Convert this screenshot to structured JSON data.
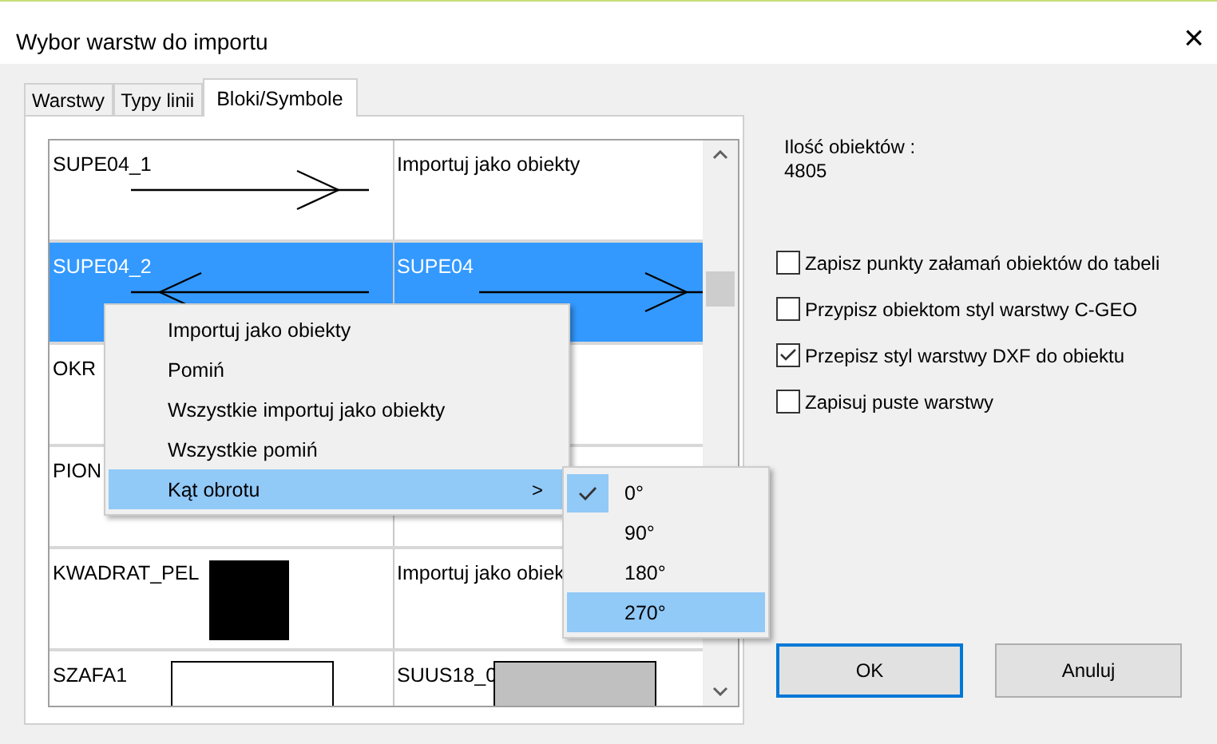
{
  "window": {
    "title": "Wybor warstw do importu",
    "close": "×"
  },
  "tabs": [
    {
      "label": "Warstwy",
      "selected": false
    },
    {
      "label": "Typy linii",
      "selected": false
    },
    {
      "label": "Bloki/Symbole",
      "selected": true
    }
  ],
  "grid": {
    "rows": [
      {
        "selected": false,
        "cells": [
          {
            "text": "SUPE04_1",
            "kind": "arrow-right"
          },
          {
            "text": "Importuj jako obiekty"
          }
        ]
      },
      {
        "selected": true,
        "cells": [
          {
            "text": "SUPE04_2",
            "kind": "arrow-left"
          },
          {
            "text": "SUPE04",
            "kind": "arrow-right"
          }
        ]
      },
      {
        "selected": false,
        "cells": [
          {
            "text": "OKR"
          },
          {}
        ]
      },
      {
        "selected": false,
        "cells": [
          {
            "text": "PION"
          },
          {}
        ]
      },
      {
        "selected": false,
        "cells": [
          {
            "text": "KWADRAT_PEL",
            "kind": "square-filled"
          },
          {
            "text": "Importuj jako obiek"
          }
        ]
      },
      {
        "selected": false,
        "cells": [
          {
            "text": "SZAFA1",
            "kind": "rect-outline"
          },
          {
            "text": "SUUS18_0",
            "kind": "rect-gray"
          }
        ]
      }
    ]
  },
  "context_menu": {
    "items": [
      {
        "label": "Importuj jako obiekty",
        "selected": false
      },
      {
        "label": "Pomiń",
        "selected": false
      },
      {
        "label": "Wszystkie importuj jako obiekty",
        "selected": false
      },
      {
        "label": "Wszystkie pomiń",
        "selected": false
      },
      {
        "label": "Kąt obrotu",
        "selected": true,
        "arrow": ">"
      }
    ]
  },
  "submenu": {
    "items": [
      {
        "label": "0°",
        "checked": true,
        "selected": false
      },
      {
        "label": "90°",
        "checked": false,
        "selected": false
      },
      {
        "label": "180°",
        "checked": false,
        "selected": false
      },
      {
        "label": "270°",
        "checked": false,
        "selected": true
      }
    ]
  },
  "object_count": {
    "label": "Ilość obiektów :",
    "value": "4805"
  },
  "options": [
    {
      "label": "Zapisz punkty załamań obiektów do tabeli",
      "checked": false
    },
    {
      "label": "Przypisz obiektom styl warstwy C-GEO",
      "checked": false
    },
    {
      "label": "Przepisz styl warstwy DXF do obiektu",
      "checked": true
    },
    {
      "label": "Zapisuj puste warstwy",
      "checked": false
    }
  ],
  "buttons": [
    {
      "label": "OK",
      "default": true
    },
    {
      "label": "Anuluj",
      "default": false
    }
  ]
}
